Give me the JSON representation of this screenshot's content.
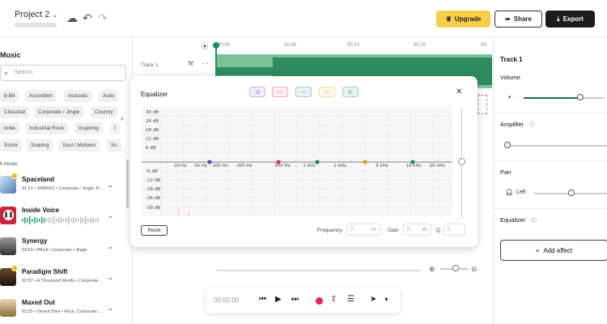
{
  "header": {
    "project_name": "Project 2",
    "upgrade_label": "Upgrade",
    "share_label": "Share",
    "export_label": "Export"
  },
  "sidebar": {
    "title": "Music",
    "search_placeholder": "Search",
    "genres": [
      "8-Bit",
      "Accordion",
      "Acoustic",
      "Actio",
      "Classical",
      "Corporate / Jingle",
      "Country",
      "Indie",
      "Industrial Rock",
      "Inspiring",
      "I",
      "Score",
      "Soaring",
      "Soul / Motown",
      "Sc"
    ],
    "section_label": "ll music",
    "tracks": [
      {
        "name": "Spaceland",
        "meta": "01:21 • SPARKZ • Corporate / Jingle, P..."
      },
      {
        "name": "Inside Voice",
        "meta": ""
      },
      {
        "name": "Synergy",
        "meta": "03:59 • PALA • Corporate / Jingle"
      },
      {
        "name": "Paradigm Shift",
        "meta": "02:57 • A Thousand Words • Corporate..."
      },
      {
        "name": "Maxed Out",
        "meta": "02:25 • Desert Dive • Rock, Corporate ..."
      }
    ]
  },
  "timeline": {
    "ruler": [
      "00:00",
      "00:05",
      "00:10",
      "00:15",
      "00:"
    ],
    "track_label": "Track 1"
  },
  "equalizer": {
    "title": "Equalizer",
    "db_labels": [
      "30 dB",
      "24 dB",
      "18 dB",
      "12 dB",
      "6 dB",
      "-6 dB",
      "-12 dB",
      "-18 dB",
      "-24 dB",
      "-30 dB"
    ],
    "freq_labels": [
      "20 Hz",
      "50 Hz",
      "100 Hz",
      "200 Hz",
      "500 Hz",
      "1 kHz",
      "2 kHz",
      "5 kHz",
      "10 kHz",
      "20 kHz"
    ],
    "band_colors": [
      "#7a3fb8",
      "#d6336c",
      "#1f7a8c",
      "#e89b1c",
      "#1a8f5a"
    ],
    "reset_label": "Reset",
    "frequency_label": "Frequency",
    "frequency_value": "0",
    "frequency_unit": "Hz",
    "gain_label": "Gain",
    "gain_value": "0",
    "gain_unit": "dB",
    "q_label": "Q",
    "q_value": "0"
  },
  "transport": {
    "timecode": "00:00.00"
  },
  "right_panel": {
    "title": "Track 1",
    "volume_label": "Volume",
    "volume_level": 0.7,
    "amplifier_label": "Amplifier",
    "pan_label": "Pan",
    "pan_side": "Left",
    "equalizer_label": "Equalizer",
    "add_effect_label": "Add effect"
  }
}
